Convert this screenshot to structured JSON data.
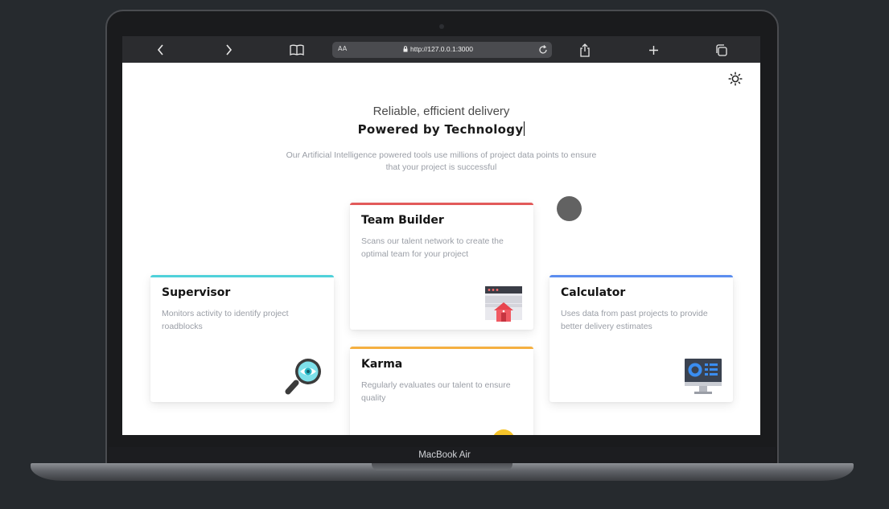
{
  "device": {
    "label": "MacBook Air"
  },
  "browser": {
    "text_size_label": "AA",
    "url": "http://127.0.0.1:3000",
    "icons": [
      "back-icon",
      "forward-icon",
      "bookmarks-icon",
      "lock-icon",
      "reload-icon",
      "share-icon",
      "new-tab-icon",
      "tabs-icon"
    ]
  },
  "page": {
    "theme_icon": "sun-icon",
    "tagline": "Reliable, efficient delivery",
    "headline": "Powered by Technology",
    "subtitle": "Our Artificial Intelligence powered tools use millions of project data points to ensure that your project is successful",
    "cards": [
      {
        "title": "Team Builder",
        "description": "Scans our talent network to create the optimal team for your project",
        "accent": "#e25a5a",
        "icon": "browser-home-icon"
      },
      {
        "title": "Supervisor",
        "description": "Monitors activity to identify project roadblocks",
        "accent": "#4fd1d9",
        "icon": "magnifier-eye-icon"
      },
      {
        "title": "Calculator",
        "description": "Uses data from past projects to provide better delivery estimates",
        "accent": "#5b8def",
        "icon": "monitor-dashboard-icon"
      },
      {
        "title": "Karma",
        "description": "Regularly evaluates our talent to ensure quality",
        "accent": "#f5b041",
        "icon": "coin-icon"
      }
    ]
  }
}
